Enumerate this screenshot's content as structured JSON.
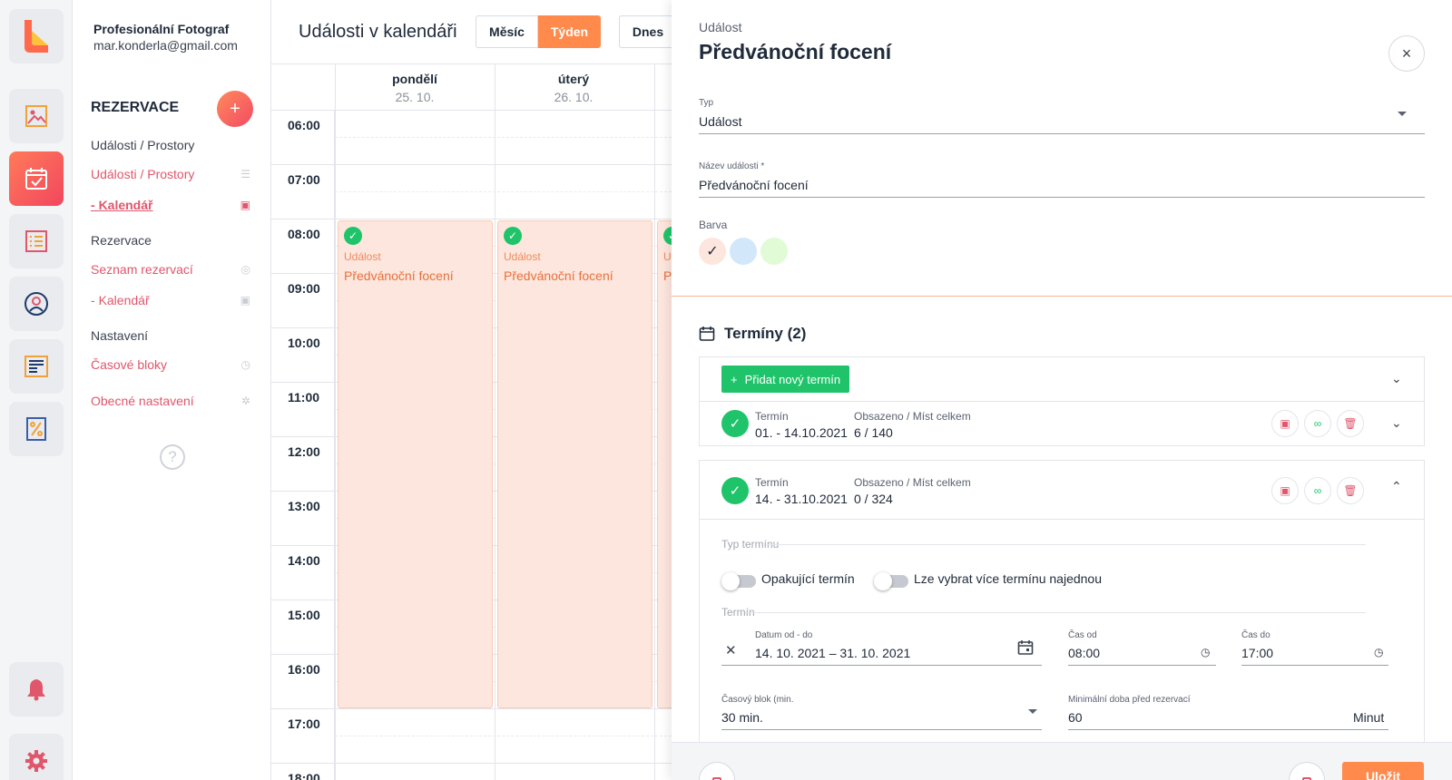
{
  "user": {
    "name": "Profesionální Fotograf",
    "email": "mar.konderla@gmail.com"
  },
  "sidebar": {
    "heading": "REZERVACE",
    "add_label": "+",
    "groups": [
      {
        "title": "Události / Prostory",
        "items": [
          {
            "label": "Události / Prostory",
            "icon": "list-icon"
          },
          {
            "label": "Kalendář",
            "icon": "calendar-icon"
          }
        ]
      },
      {
        "title": "Rezervace",
        "items": [
          {
            "label": "Seznam rezervací",
            "icon": "check-circle-icon"
          },
          {
            "label": "Kalendář",
            "icon": "calendar-icon"
          }
        ]
      },
      {
        "title": "Nastavení",
        "items": [
          {
            "label": "Časové bloky",
            "icon": "clock-icon"
          },
          {
            "label": "Obecné nastavení",
            "icon": "gear-icon"
          }
        ]
      }
    ],
    "help": "?"
  },
  "calendar": {
    "title": "Události v kalendáři",
    "view_buttons": [
      "Měsíc",
      "Týden"
    ],
    "today_button": "Dnes",
    "days": [
      {
        "name": "pondělí",
        "date": "25. 10."
      },
      {
        "name": "úterý",
        "date": "26. 10."
      }
    ],
    "hours": [
      "06:00",
      "07:00",
      "08:00",
      "09:00",
      "10:00",
      "11:00",
      "12:00",
      "13:00",
      "14:00",
      "15:00",
      "16:00",
      "17:00",
      "18:00"
    ],
    "events": [
      {
        "type": "Událost",
        "name": "Předvánoční focení"
      },
      {
        "type": "Událost",
        "name": "Předvánoční focení"
      },
      {
        "type": "Ud",
        "name": "Př"
      }
    ]
  },
  "panel": {
    "kicker": "Událost",
    "title": "Předvánoční focení",
    "close": "×",
    "type_label": "Typ",
    "type_value": "Událost",
    "name_label": "Název události *",
    "name_value": "Předvánoční focení",
    "color_label": "Barva",
    "colors": [
      "#fde6dd",
      "#d3e7fb",
      "#e1fbd7"
    ],
    "terms_title": "Termíny (2)",
    "add_term": "Přidat nový termín",
    "term_label": "Termín",
    "capacity_label": "Obsazeno / Míst celkem",
    "terms": [
      {
        "range": "01. - 14.10.2021",
        "capacity": "6 / 140"
      },
      {
        "range": "14. - 31.10.2021",
        "capacity": "0 / 324"
      }
    ],
    "section_type": "Typ termínu",
    "toggle_repeat": "Opakující termín",
    "toggle_multi": "Lze vybrat více termínu najednou",
    "section_term": "Termín",
    "date_label": "Datum od - do",
    "date_value": "14. 10. 2021 – 31. 10. 2021",
    "time_from_label": "Čas od",
    "time_from": "08:00",
    "time_to_label": "Čas do",
    "time_to": "17:00",
    "block_label": "Časový blok (min.",
    "block_value": "30 min.",
    "min_label": "Minimální doba před rezervací",
    "min_value": "60",
    "min_unit": "Minut",
    "save": "Uložit"
  },
  "colors": {
    "accent": "#ff8a4c",
    "pink": "#e0566b",
    "green": "#1fc46a"
  }
}
